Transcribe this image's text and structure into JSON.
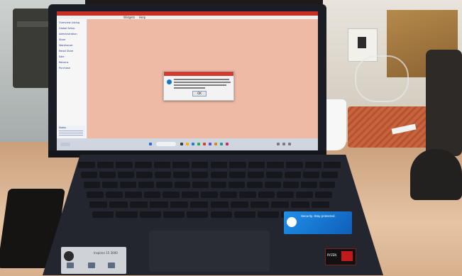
{
  "app": {
    "menu": [
      "",
      "",
      "",
      "",
      "Widgets",
      "Help"
    ],
    "nav_items": [
      "Overview Listing",
      "Global Setup",
      "Administration",
      "Store",
      "Warehouse",
      "Retail Store",
      "Sale",
      "Returns",
      "Purchase"
    ],
    "footer_label": "Notes"
  },
  "dialog": {
    "ok_label": "OK"
  },
  "stickers": {
    "blue": [
      "Security. Stay protected.",
      "",
      ""
    ],
    "gray": "Inspiron 15 3000",
    "amd": "RYZEN"
  },
  "colors": {
    "canvas": "#eeb9a5",
    "dialog_title": "#d33b2f",
    "info_icon": "#1677c9",
    "sticker_blue": "#1f8fe8"
  }
}
